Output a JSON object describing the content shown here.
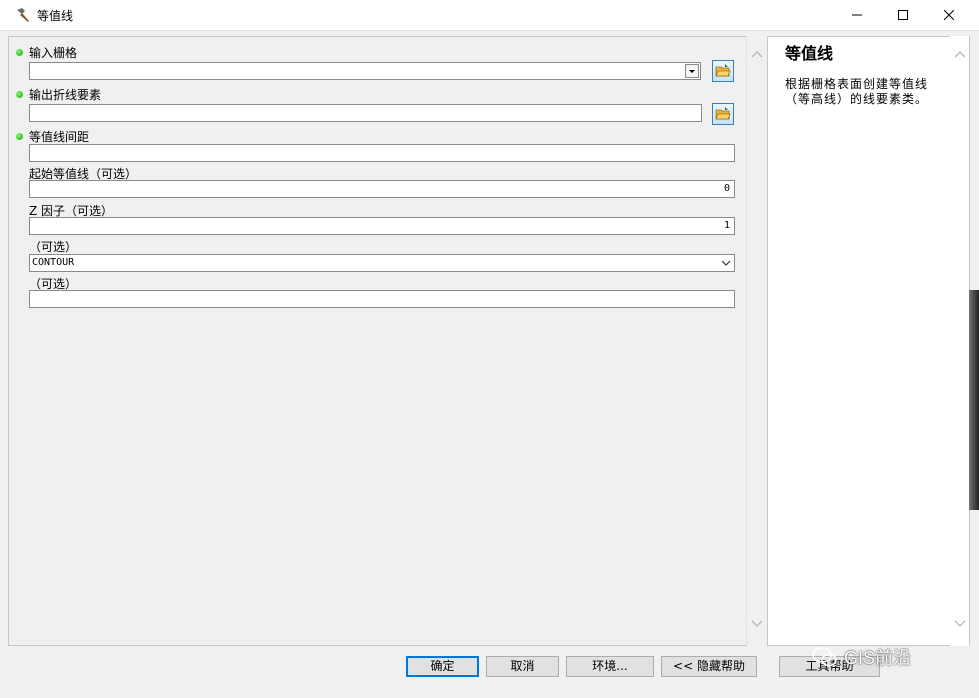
{
  "window": {
    "title": "等值线",
    "icon": "hammer-icon",
    "controls": [
      "minimize-icon",
      "maximize-icon",
      "close-icon"
    ]
  },
  "form": {
    "input_raster": {
      "label": "输入栅格",
      "value": "",
      "required": true
    },
    "output_polyline": {
      "label": "输出折线要素",
      "value": "",
      "required": true
    },
    "contour_interval": {
      "label": "等值线间距",
      "value": "",
      "required": true
    },
    "base_contour": {
      "label": "起始等值线（可选）",
      "value": "0"
    },
    "z_factor": {
      "label": "Z 因子（可选）",
      "value": "1"
    },
    "contour_type": {
      "label": "（可选）",
      "value": "CONTOUR"
    },
    "max_vertices": {
      "label": "（可选）",
      "value": ""
    }
  },
  "help": {
    "title": "等值线",
    "description": "根据栅格表面创建等值线（等高线）的线要素类。"
  },
  "buttons": {
    "ok": "确定",
    "cancel": "取消",
    "environments": "环境...",
    "hide_help": "<< 隐藏帮助",
    "tool_help": "工具帮助"
  },
  "watermark": "GIS前沿",
  "colors": {
    "required_dot": "#22a812",
    "default_button_border": "#0078d7"
  }
}
